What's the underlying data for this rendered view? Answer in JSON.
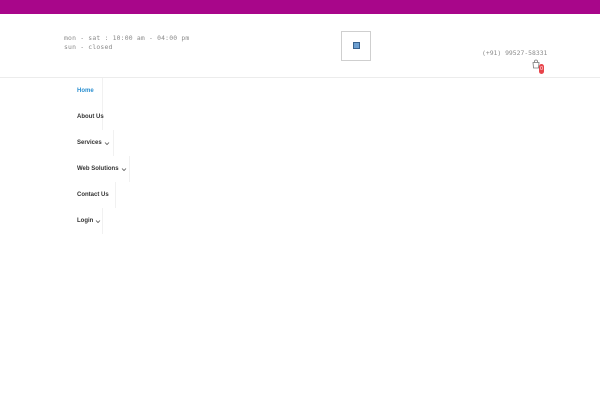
{
  "header": {
    "hours_line1": "mon - sat : 10:00 am - 04:00 pm",
    "hours_line2": "sun - closed",
    "phone": "(+91) 99527-58331",
    "cart_count": "0"
  },
  "nav": {
    "items": [
      {
        "label": "Home",
        "active": true
      },
      {
        "label": "About Us"
      },
      {
        "label": "Services",
        "has_dropdown": true
      },
      {
        "label": "Web Solutions",
        "has_dropdown": true
      },
      {
        "label": "Contact Us"
      },
      {
        "label": "Login",
        "has_dropdown": true
      }
    ]
  },
  "icons": {
    "cart": "shopping-bag-icon",
    "dropdown": "chevron-down-icon",
    "logo": "logo-image"
  },
  "colors": {
    "topbar": "#a8068a",
    "nav_active": "#2a8fd0",
    "cart_badge": "#e8434a"
  }
}
